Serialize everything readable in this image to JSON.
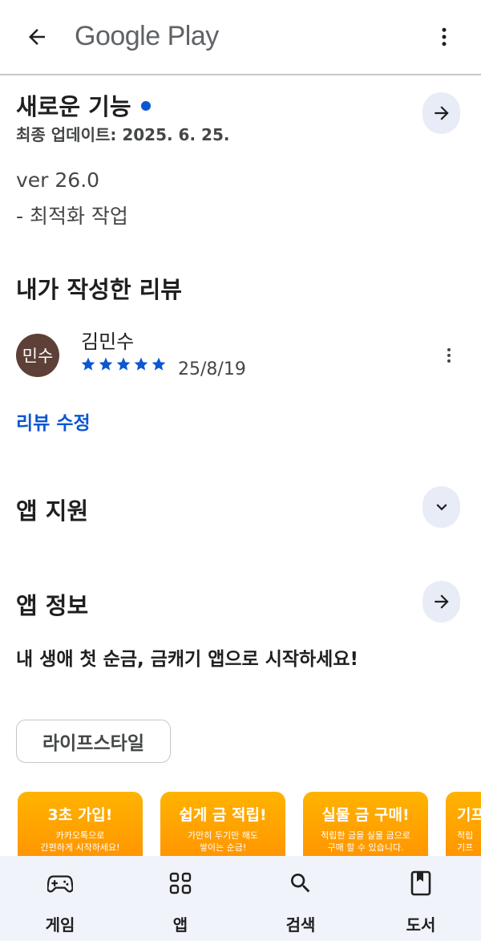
{
  "header": {
    "title": "Google Play",
    "back_icon": "arrow-left-icon",
    "menu_icon": "more-vert-icon"
  },
  "whats_new": {
    "title": "새로운 기능",
    "last_updated": "최종 업데이트: 2025. 6. 25.",
    "version": "ver 26.0",
    "note": "- 최적화 작업",
    "indicator_color": "#0b57d0"
  },
  "my_review": {
    "title": "내가 작성한 리뷰",
    "avatar_text": "민수",
    "avatar_color": "#5d4037",
    "reviewer_name": "김민수",
    "rating": 5,
    "date": "25/8/19",
    "edit_label": "리뷰 수정"
  },
  "app_support": {
    "title": "앱 지원",
    "expand_icon": "chevron-down-icon"
  },
  "app_info": {
    "title": "앱 정보",
    "description": "내 생애 첫 순금, 금캐기 앱으로 시작하세요!",
    "category_chip": "라이프스타일"
  },
  "promos": [
    {
      "title": "3초 가입!",
      "line1": "카카오톡으로",
      "line2": "간편하게 시작하세요!"
    },
    {
      "title": "쉽게 금 적립!",
      "line1": "가만히 두기만 해도",
      "line2": "쌓이는 순금!"
    },
    {
      "title": "실물 금 구매!",
      "line1": "적립한 금을 실물 금으로",
      "line2": "구매 할 수 있습니다."
    },
    {
      "title": "기프",
      "line1": "적립",
      "line2": "기프"
    }
  ],
  "bottom_nav": [
    {
      "label": "게임",
      "icon": "gamepad-icon"
    },
    {
      "label": "앱",
      "icon": "apps-grid-icon"
    },
    {
      "label": "검색",
      "icon": "search-icon"
    },
    {
      "label": "도서",
      "icon": "book-icon"
    }
  ],
  "colors": {
    "accent": "#0b57d0",
    "star": "#0b57d0",
    "round_button_bg": "#e8ecf6",
    "nav_bg": "#f0f3fa",
    "promo_orange": "#ffa000"
  }
}
